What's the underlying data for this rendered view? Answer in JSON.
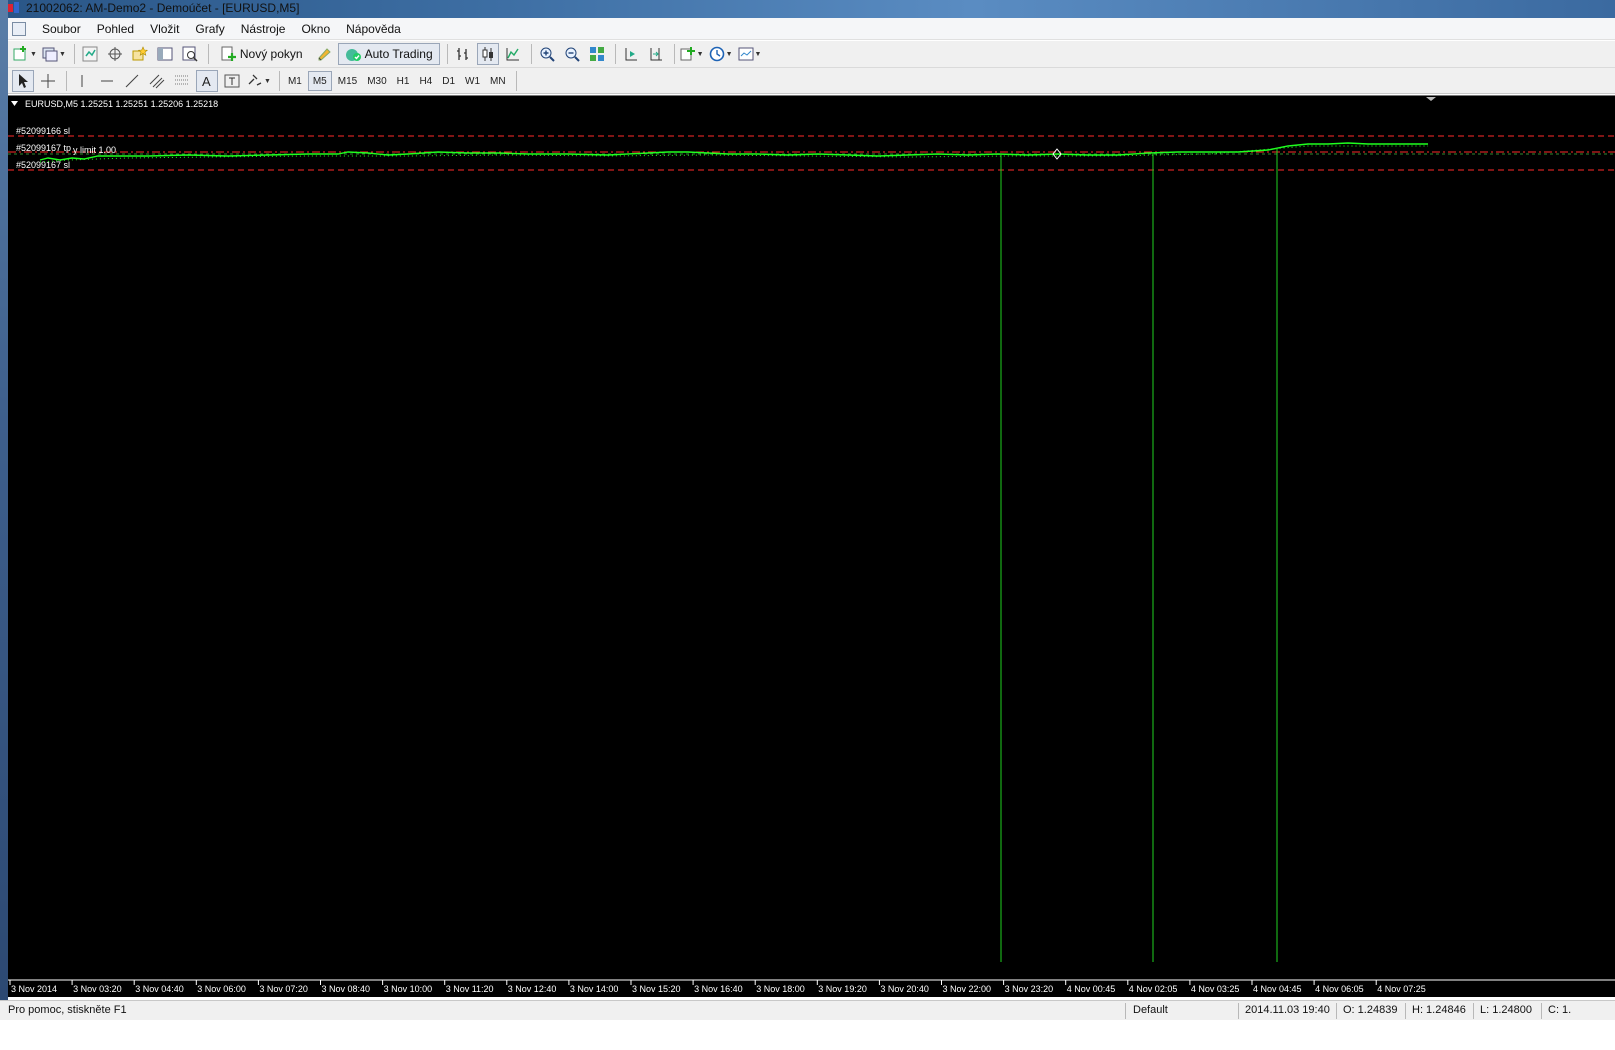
{
  "window": {
    "title": "21002062: AM-Demo2 - Demoúčet - [EURUSD,M5]"
  },
  "menu": {
    "items": [
      "Soubor",
      "Pohled",
      "Vložit",
      "Grafy",
      "Nástroje",
      "Okno",
      "Nápověda"
    ]
  },
  "toolbar": {
    "new_order_label": "Nový pokyn",
    "auto_trading_label": "Auto Trading"
  },
  "timeframes": {
    "items": [
      "M1",
      "M5",
      "M15",
      "M30",
      "H1",
      "H4",
      "D1",
      "W1",
      "MN"
    ],
    "selected": "M5"
  },
  "chart": {
    "header": "EURUSD,M5  1.25251 1.25251 1.25206 1.25218",
    "order_labels": {
      "sl_top": "#52099166 sl",
      "tp": "#52099167 tp",
      "limit": "y limit 1.00",
      "sl_bottom": "#52099167 sl"
    },
    "time_labels": [
      "3 Nov 2014",
      "3 Nov 03:20",
      "3 Nov 04:40",
      "3 Nov 06:00",
      "3 Nov 07:20",
      "3 Nov 08:40",
      "3 Nov 10:00",
      "3 Nov 11:20",
      "3 Nov 12:40",
      "3 Nov 14:00",
      "3 Nov 15:20",
      "3 Nov 16:40",
      "3 Nov 18:00",
      "3 Nov 19:20",
      "3 Nov 20:40",
      "3 Nov 22:00",
      "3 Nov 23:20",
      "4 Nov 00:45",
      "4 Nov 02:05",
      "4 Nov 03:25",
      "4 Nov 04:45",
      "4 Nov 06:05",
      "4 Nov 07:25"
    ],
    "colors": {
      "background": "#000000",
      "price": "#00ff00",
      "order_line": "#ff0000",
      "spike": "#00ff00"
    }
  },
  "status": {
    "help": "Pro pomoc, stiskněte F1",
    "profile": "Default",
    "datetime": "2014.11.03 19:40",
    "open": "O: 1.24839",
    "high": "H: 1.24846",
    "low": "L: 1.24800",
    "close": "C: 1."
  }
}
